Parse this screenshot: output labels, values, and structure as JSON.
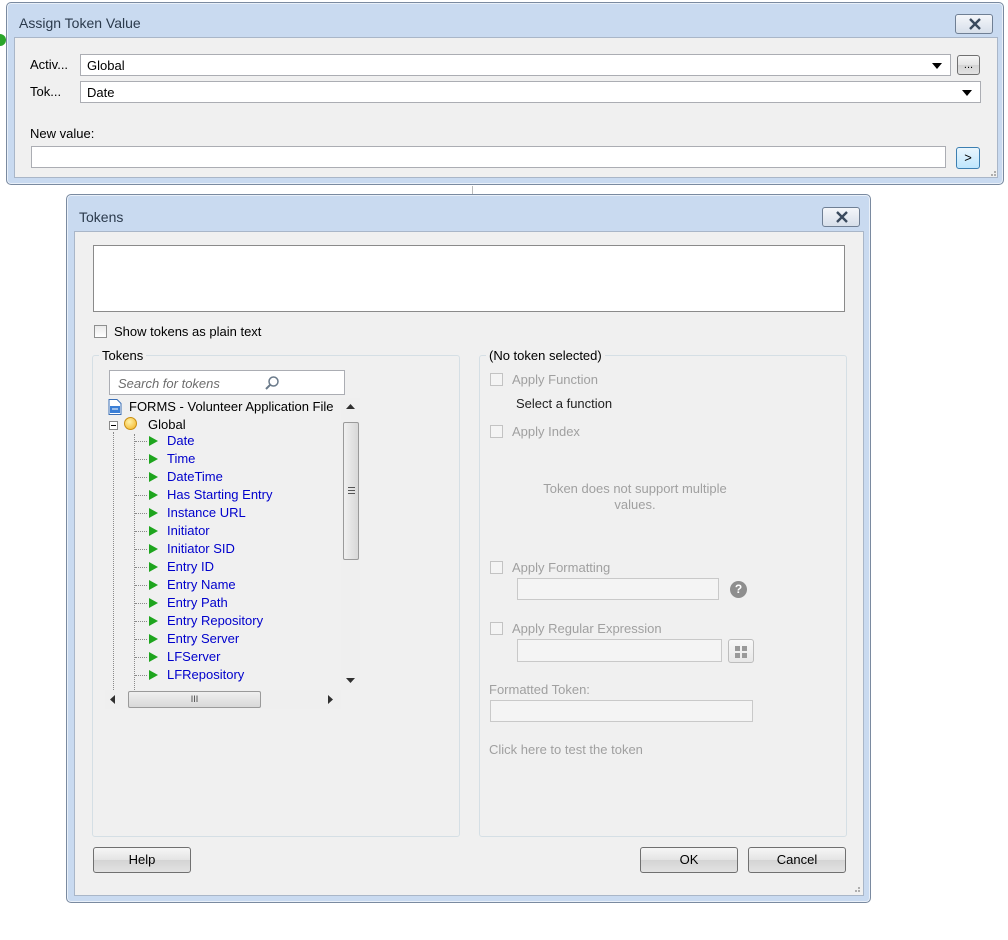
{
  "assign_dialog": {
    "title": "Assign Token Value",
    "activity_label": "Activ...",
    "activity_value": "Global",
    "browse_label": "...",
    "token_label": "Tok...",
    "token_value": "Date",
    "new_value_label": "New value:",
    "new_value": "",
    "insert_label": ">"
  },
  "tokens_dialog": {
    "title": "Tokens",
    "token_text": "",
    "show_plain_text_label": "Show tokens as plain text",
    "tokens_group_label": "Tokens",
    "search_placeholder": "Search for tokens",
    "tree": {
      "root": "FORMS - Volunteer Application File",
      "group": "Global",
      "items": [
        "Date",
        "Time",
        "DateTime",
        "Has Starting Entry",
        "Instance URL",
        "Initiator",
        "Initiator SID",
        "Entry ID",
        "Entry Name",
        "Entry Path",
        "Entry Repository",
        "Entry Server",
        "LFServer",
        "LFRepository"
      ]
    },
    "hscroll_thumb_label": "III",
    "detail_group_label": "(No token selected)",
    "apply_function_label": "Apply Function",
    "select_function_label": "Select a function",
    "apply_index_label": "Apply Index",
    "multiple_values_msg_line1": "Token does not support multiple",
    "multiple_values_msg_line2": "values.",
    "apply_formatting_label": "Apply Formatting",
    "help_icon_text": "?",
    "apply_regex_label": "Apply Regular Expression",
    "formatted_token_label": "Formatted Token:",
    "test_link": "Click here to test the token",
    "help_button": "Help",
    "ok_button": "OK",
    "cancel_button": "Cancel"
  }
}
